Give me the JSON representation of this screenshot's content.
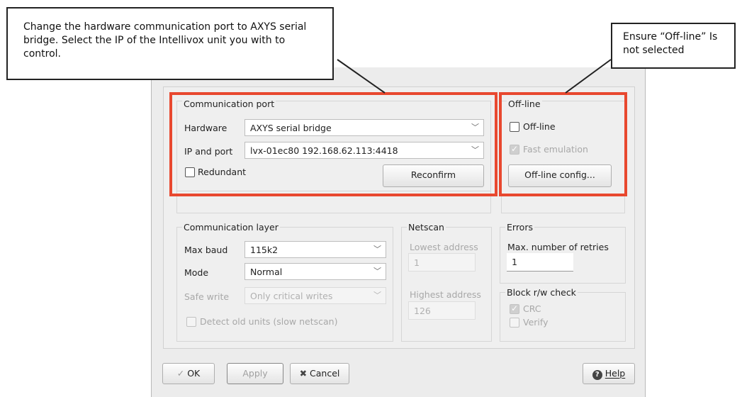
{
  "callouts": {
    "left": "Change the hardware communication port to AXYS serial bridge.  Select the IP of the Intellivox unit you with to control.",
    "right": "Ensure “Off-line” Is not selected"
  },
  "comm_port": {
    "legend": "Communication port",
    "hardware_label": "Hardware",
    "hardware_value": "AXYS serial bridge",
    "ip_label": "IP and port",
    "ip_value": "lvx-01ec80 192.168.62.113:4418",
    "redundant_label": "Redundant",
    "reconfirm_label": "Reconfirm"
  },
  "offline": {
    "legend": "Off-line",
    "offline_label": "Off-line",
    "fast_emulation_label": "Fast emulation",
    "config_label": "Off-line config..."
  },
  "comm_layer": {
    "legend": "Communication layer",
    "max_baud_label": "Max baud",
    "max_baud_value": "115k2",
    "mode_label": "Mode",
    "mode_value": "Normal",
    "safe_write_label": "Safe write",
    "safe_write_value": "Only critical writes",
    "detect_label": "Detect old units (slow netscan)"
  },
  "netscan": {
    "legend": "Netscan",
    "lowest_label": "Lowest address",
    "lowest_value": "1",
    "highest_label": "Highest address",
    "highest_value": "126"
  },
  "errors": {
    "legend": "Errors",
    "retries_label": "Max. number of retries",
    "retries_value": "1"
  },
  "block_check": {
    "legend": "Block r/w check",
    "crc_label": "CRC",
    "verify_label": "Verify"
  },
  "buttons": {
    "ok": "OK",
    "apply": "Apply",
    "cancel": "Cancel",
    "help": "Help"
  },
  "colors": {
    "highlight": "#e8482f"
  }
}
